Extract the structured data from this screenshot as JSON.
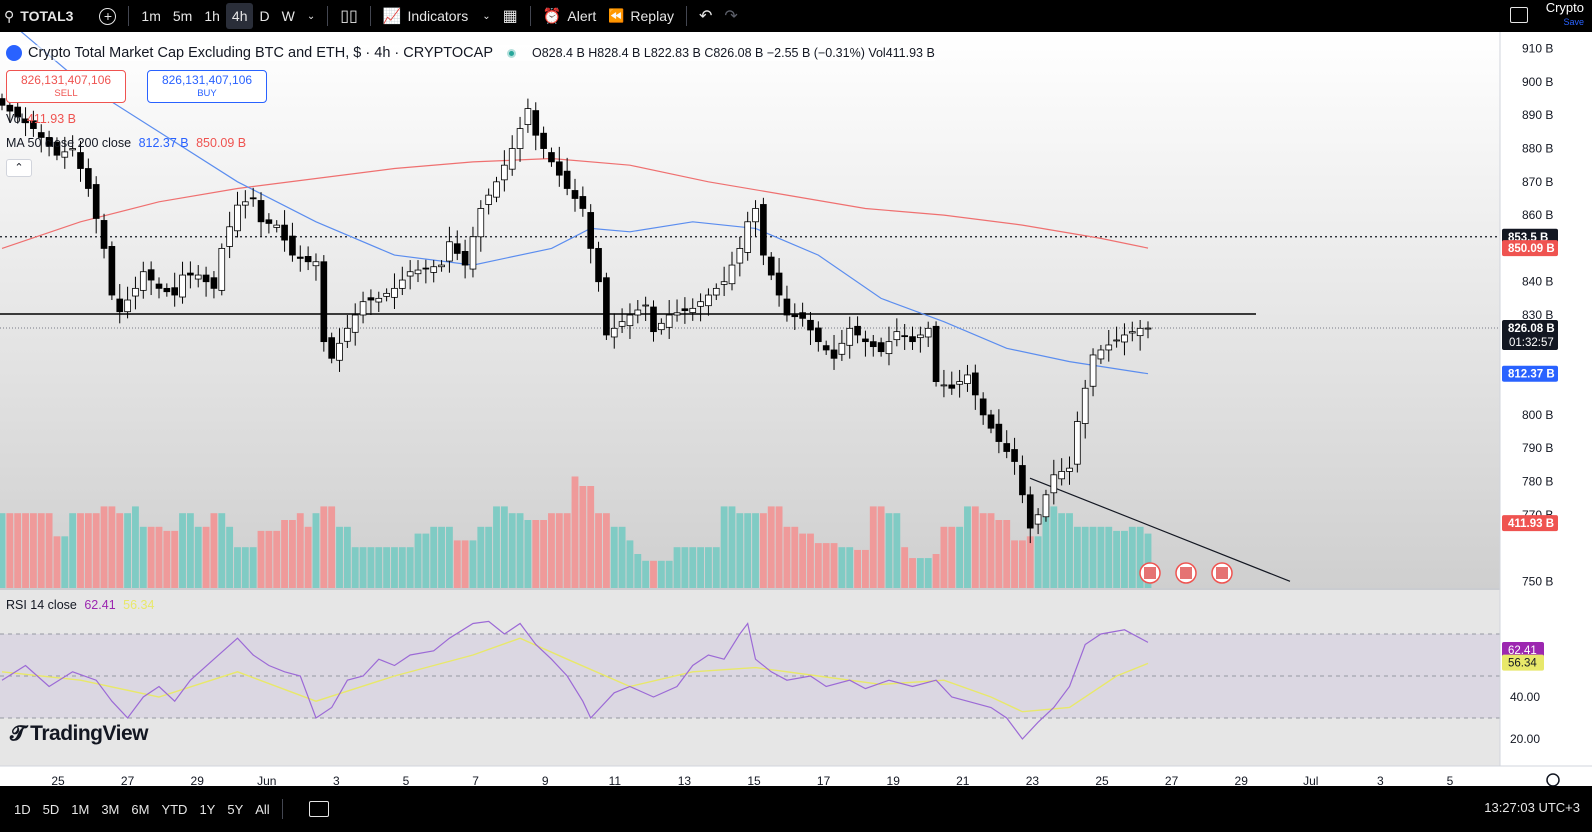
{
  "toolbar": {
    "symbol": "TOTAL3",
    "timeframes": [
      "1m",
      "5m",
      "1h",
      "4h",
      "D",
      "W"
    ],
    "active_timeframe": "4h",
    "indicators_label": "Indicators",
    "alert_label": "Alert",
    "replay_label": "Replay",
    "workspace_label": "Crypto",
    "workspace_sub": "Save"
  },
  "legend": {
    "title": "Crypto Total Market Cap Excluding BTC and ETH, $ · 4h · CRYPTOCAP",
    "ohlc": "O828.4 B  H828.4 B  L822.83 B  C826.08 B  −2.55 B (−0.31%)  Vol411.93 B",
    "sell_price": "826,131,407,106",
    "sell_label": "SELL",
    "buy_price": "826,131,407,106",
    "buy_label": "BUY",
    "vol_label": "Vol",
    "vol_value": "411.93 B",
    "ma_label": "MA 50 close 200 close",
    "ma50_value": "812.37 B",
    "ma200_value": "850.09 B",
    "rsi_label": "RSI 14 close",
    "rsi_value": "62.41",
    "rsi_ma_value": "56.34",
    "brand": "TradingView"
  },
  "bottom": {
    "ranges": [
      "1D",
      "5D",
      "1M",
      "3M",
      "6M",
      "YTD",
      "1Y",
      "5Y",
      "All"
    ],
    "clock": "13:27:03 UTC+3"
  },
  "colors": {
    "up": "#ffffff",
    "down": "#000000",
    "vol_up": "#80cbc4",
    "vol_down": "#ef9a9a",
    "ma50": "#5b8def",
    "ma200": "#ef7070",
    "rsi": "#9c6ad6",
    "rsi_ma": "#e8e86a"
  },
  "chart_data": {
    "type": "candlestick",
    "y_axis_ticks": [
      "910 B",
      "900 B",
      "890 B",
      "880 B",
      "870 B",
      "860 B",
      "840 B",
      "830 B",
      "800 B",
      "790 B",
      "780 B",
      "770 B",
      "750 B"
    ],
    "y_axis_values": [
      910,
      900,
      890,
      880,
      870,
      860,
      840,
      830,
      800,
      790,
      780,
      770,
      750
    ],
    "ylim": [
      745,
      912
    ],
    "x_axis_ticks": [
      "25",
      "27",
      "29",
      "Jun",
      "3",
      "5",
      "7",
      "9",
      "11",
      "13",
      "15",
      "17",
      "19",
      "21",
      "23",
      "25",
      "27",
      "29",
      "Jul",
      "3",
      "5"
    ],
    "price_labels": [
      {
        "text": "853.5 B",
        "value": 853.5,
        "style": "dark"
      },
      {
        "text": "850.09 B",
        "value": 850.09,
        "style": "red"
      },
      {
        "text": "826.08 B",
        "value": 826.08,
        "style": "dark",
        "sub": "01:32:57"
      },
      {
        "text": "812.37 B",
        "value": 812.37,
        "style": "blue"
      },
      {
        "text": "411.93 B",
        "value": 767.5,
        "style": "red"
      }
    ],
    "horizontal_lines": [
      {
        "value": 853.5,
        "style": "dotted"
      },
      {
        "value": 830.3,
        "style": "solid"
      },
      {
        "value": 826.08,
        "style": "dotted-light"
      }
    ],
    "trendline": {
      "from": {
        "date": "Jun 22",
        "value": 781
      },
      "to": {
        "date": "Jun 28",
        "value": 750
      }
    },
    "close_path": [
      [
        0,
        893
      ],
      [
        4,
        886
      ],
      [
        7,
        878
      ],
      [
        9,
        880
      ],
      [
        11,
        868
      ],
      [
        13,
        850
      ],
      [
        14,
        836
      ],
      [
        15,
        831
      ],
      [
        17,
        838
      ],
      [
        18,
        843
      ],
      [
        20,
        838
      ],
      [
        22,
        836
      ],
      [
        23,
        842
      ],
      [
        25,
        842
      ],
      [
        27,
        838
      ],
      [
        28,
        850
      ],
      [
        30,
        863
      ],
      [
        32,
        865
      ],
      [
        33,
        858
      ],
      [
        35,
        857
      ],
      [
        37,
        848
      ],
      [
        39,
        846
      ],
      [
        40,
        846
      ],
      [
        41,
        822
      ],
      [
        42,
        817
      ],
      [
        44,
        826
      ],
      [
        46,
        834
      ],
      [
        48,
        835
      ],
      [
        50,
        838
      ],
      [
        52,
        843
      ],
      [
        54,
        844
      ],
      [
        56,
        845
      ],
      [
        57,
        852
      ],
      [
        59,
        845
      ],
      [
        61,
        862
      ],
      [
        63,
        870
      ],
      [
        65,
        880
      ],
      [
        66,
        886
      ],
      [
        67,
        892
      ],
      [
        68,
        884
      ],
      [
        70,
        876
      ],
      [
        72,
        868
      ],
      [
        74,
        862
      ],
      [
        75,
        850
      ],
      [
        76,
        840
      ],
      [
        77,
        824
      ],
      [
        78,
        826
      ],
      [
        80,
        830
      ],
      [
        82,
        833
      ],
      [
        83,
        825
      ],
      [
        85,
        830
      ],
      [
        88,
        832
      ],
      [
        90,
        836
      ],
      [
        92,
        840
      ],
      [
        94,
        850
      ],
      [
        95,
        858
      ],
      [
        96,
        862
      ],
      [
        97,
        848
      ],
      [
        98,
        842
      ],
      [
        99,
        836
      ],
      [
        100,
        830
      ],
      [
        102,
        829
      ],
      [
        104,
        822
      ],
      [
        106,
        817
      ],
      [
        108,
        826
      ],
      [
        110,
        822
      ],
      [
        112,
        819
      ],
      [
        114,
        825
      ],
      [
        116,
        822
      ],
      [
        118,
        826
      ],
      [
        119,
        810
      ],
      [
        121,
        808
      ],
      [
        123,
        812
      ],
      [
        125,
        800
      ],
      [
        127,
        792
      ],
      [
        129,
        786
      ],
      [
        131,
        766
      ],
      [
        132,
        770
      ],
      [
        134,
        782
      ],
      [
        136,
        784
      ],
      [
        137,
        798
      ],
      [
        139,
        818
      ],
      [
        141,
        821
      ],
      [
        143,
        824
      ],
      [
        145,
        826
      ],
      [
        146,
        826.08
      ]
    ],
    "volume_levels": [
      0.55,
      0.55,
      0.55,
      0.55,
      0.55,
      0.55,
      0.55,
      0.38,
      0.38,
      0.55,
      0.55,
      0.55,
      0.55,
      0.6,
      0.6,
      0.55,
      0.55,
      0.6,
      0.45,
      0.45,
      0.45,
      0.42,
      0.42,
      0.55,
      0.55,
      0.45,
      0.45,
      0.55,
      0.55,
      0.45,
      0.3,
      0.3,
      0.3,
      0.42,
      0.42,
      0.42,
      0.5,
      0.5,
      0.55,
      0.45,
      0.55,
      0.6,
      0.6,
      0.45,
      0.45,
      0.3,
      0.3,
      0.3,
      0.3,
      0.3,
      0.3,
      0.3,
      0.3,
      0.4,
      0.4,
      0.45,
      0.45,
      0.45,
      0.35,
      0.35,
      0.35,
      0.45,
      0.45,
      0.6,
      0.6,
      0.55,
      0.55,
      0.5,
      0.5,
      0.5,
      0.55,
      0.55,
      0.55,
      0.82,
      0.75,
      0.75,
      0.55,
      0.55,
      0.45,
      0.45,
      0.35,
      0.25,
      0.2,
      0.2,
      0.2,
      0.2,
      0.3,
      0.3,
      0.3,
      0.3,
      0.3,
      0.3,
      0.6,
      0.6,
      0.55,
      0.55,
      0.55,
      0.55,
      0.6,
      0.6,
      0.45,
      0.45,
      0.4,
      0.4,
      0.33,
      0.33,
      0.33,
      0.3,
      0.3,
      0.28,
      0.28,
      0.6,
      0.6,
      0.55,
      0.55,
      0.3,
      0.22,
      0.22,
      0.22,
      0.25,
      0.45,
      0.45,
      0.45,
      0.6,
      0.6,
      0.55,
      0.55,
      0.5,
      0.5,
      0.35,
      0.35,
      0.38,
      0.38,
      0.6,
      0.6,
      0.55,
      0.55,
      0.45,
      0.45,
      0.45,
      0.45,
      0.45,
      0.42,
      0.42,
      0.45,
      0.45
    ],
    "rsi_ylim": [
      10,
      90
    ],
    "rsi_bands": [
      30,
      50,
      70
    ],
    "rsi_ticks": [
      "62.41",
      "56.34",
      "40.00",
      "20.00"
    ],
    "rsi_path": [
      [
        0,
        48
      ],
      [
        3,
        55
      ],
      [
        6,
        45
      ],
      [
        9,
        52
      ],
      [
        12,
        48
      ],
      [
        14,
        38
      ],
      [
        16,
        30
      ],
      [
        18,
        40
      ],
      [
        20,
        45
      ],
      [
        22,
        38
      ],
      [
        24,
        48
      ],
      [
        27,
        58
      ],
      [
        30,
        68
      ],
      [
        32,
        60
      ],
      [
        34,
        55
      ],
      [
        36,
        52
      ],
      [
        38,
        50
      ],
      [
        40,
        30
      ],
      [
        42,
        35
      ],
      [
        44,
        48
      ],
      [
        46,
        50
      ],
      [
        48,
        58
      ],
      [
        50,
        55
      ],
      [
        52,
        60
      ],
      [
        55,
        62
      ],
      [
        57,
        68
      ],
      [
        60,
        75
      ],
      [
        62,
        76
      ],
      [
        64,
        70
      ],
      [
        66,
        75
      ],
      [
        68,
        65
      ],
      [
        70,
        58
      ],
      [
        72,
        50
      ],
      [
        74,
        38
      ],
      [
        75,
        30
      ],
      [
        78,
        42
      ],
      [
        80,
        45
      ],
      [
        83,
        40
      ],
      [
        86,
        45
      ],
      [
        88,
        55
      ],
      [
        90,
        60
      ],
      [
        92,
        58
      ],
      [
        94,
        70
      ],
      [
        95,
        75
      ],
      [
        96,
        58
      ],
      [
        98,
        52
      ],
      [
        100,
        48
      ],
      [
        103,
        50
      ],
      [
        105,
        45
      ],
      [
        108,
        48
      ],
      [
        110,
        44
      ],
      [
        113,
        48
      ],
      [
        116,
        45
      ],
      [
        119,
        48
      ],
      [
        121,
        40
      ],
      [
        123,
        38
      ],
      [
        126,
        35
      ],
      [
        128,
        30
      ],
      [
        130,
        20
      ],
      [
        132,
        28
      ],
      [
        134,
        35
      ],
      [
        136,
        45
      ],
      [
        138,
        65
      ],
      [
        140,
        70
      ],
      [
        143,
        72
      ],
      [
        145,
        68
      ],
      [
        146,
        66
      ]
    ],
    "rsi_ma_path": [
      [
        0,
        52
      ],
      [
        10,
        48
      ],
      [
        20,
        40
      ],
      [
        30,
        52
      ],
      [
        40,
        38
      ],
      [
        50,
        50
      ],
      [
        60,
        60
      ],
      [
        66,
        68
      ],
      [
        72,
        58
      ],
      [
        80,
        45
      ],
      [
        88,
        52
      ],
      [
        96,
        54
      ],
      [
        104,
        50
      ],
      [
        112,
        46
      ],
      [
        120,
        48
      ],
      [
        126,
        40
      ],
      [
        130,
        33
      ],
      [
        136,
        35
      ],
      [
        142,
        50
      ],
      [
        146,
        56
      ]
    ],
    "ma50_path": [
      [
        0,
        920
      ],
      [
        10,
        900
      ],
      [
        20,
        885
      ],
      [
        30,
        870
      ],
      [
        40,
        858
      ],
      [
        50,
        848
      ],
      [
        60,
        845
      ],
      [
        70,
        850
      ],
      [
        75,
        856
      ],
      [
        80,
        855
      ],
      [
        88,
        858
      ],
      [
        96,
        856
      ],
      [
        104,
        848
      ],
      [
        112,
        835
      ],
      [
        120,
        828
      ],
      [
        128,
        820
      ],
      [
        136,
        816
      ],
      [
        146,
        812.37
      ]
    ],
    "ma200_path": [
      [
        0,
        850
      ],
      [
        10,
        858
      ],
      [
        20,
        864
      ],
      [
        30,
        868
      ],
      [
        40,
        871
      ],
      [
        50,
        874
      ],
      [
        60,
        876
      ],
      [
        70,
        877
      ],
      [
        80,
        875
      ],
      [
        90,
        870
      ],
      [
        100,
        866
      ],
      [
        110,
        862
      ],
      [
        120,
        860
      ],
      [
        130,
        857
      ],
      [
        140,
        853
      ],
      [
        146,
        850.09
      ]
    ]
  }
}
